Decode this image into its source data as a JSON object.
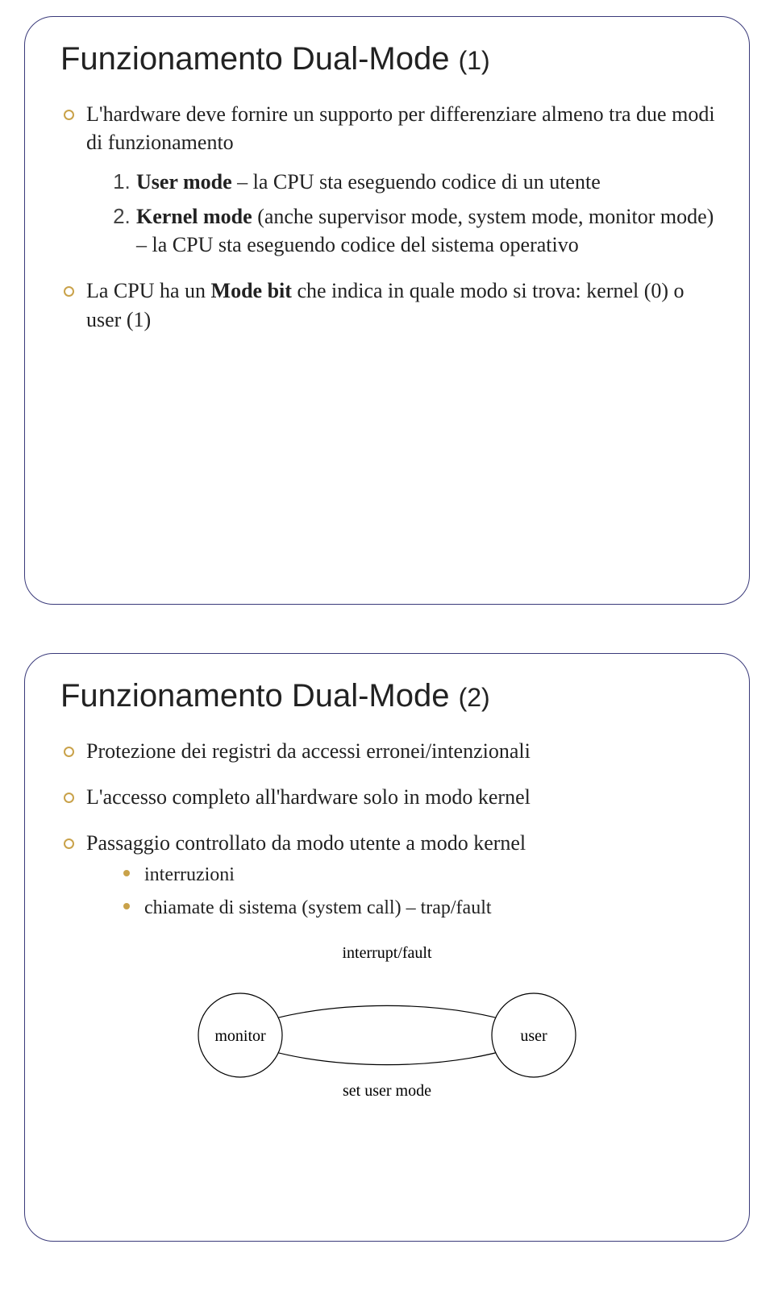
{
  "slide1": {
    "title_main": "Funzionamento Dual-Mode ",
    "title_num": "(1)",
    "bullet1": "L'hardware deve fornire un supporto per differenziare almeno tra due modi di funzionamento",
    "num1_pre": "User mode",
    "num1_post": " – la CPU sta eseguendo codice di un utente",
    "num2_pre": "Kernel mode",
    "num2_post": " (anche supervisor mode, system mode, monitor mode) – la CPU sta eseguendo codice del sistema operativo",
    "bullet2_a": "La CPU ha un ",
    "bullet2_b": "Mode bit",
    "bullet2_c": " che indica in quale modo si trova: kernel (0) o user (1)"
  },
  "slide2": {
    "title_main": "Funzionamento Dual-Mode ",
    "title_num": "(2)",
    "b1": "Protezione dei registri da accessi erronei/intenzionali",
    "b2": "L'accesso completo all'hardware solo in modo kernel",
    "b3": "Passaggio controllato da modo utente a modo kernel",
    "s1": "interruzioni",
    "s2": "chiamate di sistema (system call) – trap/fault",
    "diagram": {
      "top": "interrupt/fault",
      "left": "monitor",
      "right": "user",
      "bottom": "set user mode"
    }
  }
}
